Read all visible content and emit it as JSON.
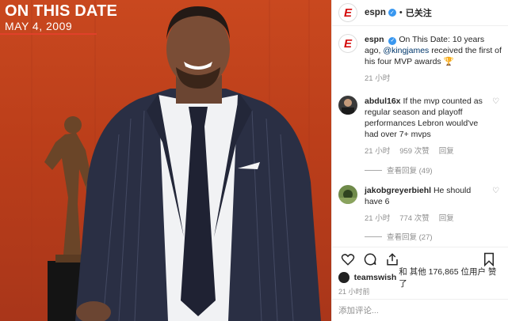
{
  "photo": {
    "title": "ON THIS DATE",
    "date": "MAY 4, 2009"
  },
  "header": {
    "handle": "espn",
    "dot": "•",
    "follow": "已关注"
  },
  "caption": {
    "handle": "espn",
    "text_pre": "On This Date: 10 years ago,",
    "mention": "@kingjames",
    "text_post": "received the first of his four MVP awards 🏆",
    "time": "21 小时"
  },
  "comments": [
    {
      "user": "abdul16x",
      "text": "If the mvp counted as regular season and playoff performances Lebron would've had over 7+ mvps",
      "time": "21 小时",
      "likes": "959 次赞",
      "reply": "回复",
      "view_replies": "查看回复 (49)"
    },
    {
      "user": "jakobgreyerbiehl",
      "text": "He should have 6",
      "time": "21 小时",
      "likes": "774 次赞",
      "reply": "回复",
      "view_replies": "查看回复 (27)"
    }
  ],
  "likes_line": {
    "user": "teamswish",
    "text": "和 其他 176,865 位用户 赞了"
  },
  "post_time": "21 小时前",
  "add_comment": {
    "placeholder": "添加评论..."
  },
  "colors": {
    "espn_red": "#d50a0a",
    "verified": "#3897f0",
    "photo_bg": "#c9481f"
  },
  "icons": [
    "heart-icon",
    "comment-icon",
    "share-icon",
    "bookmark-icon",
    "verified-icon"
  ]
}
